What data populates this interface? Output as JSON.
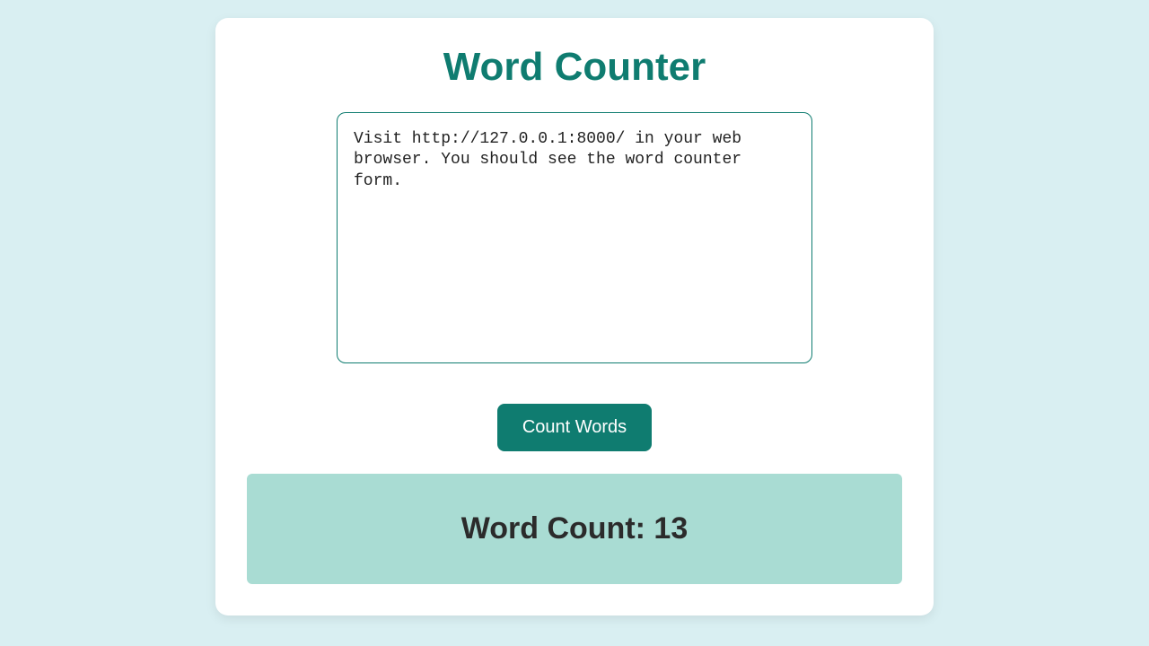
{
  "header": {
    "title": "Word Counter"
  },
  "form": {
    "textarea_value": "Visit http://127.0.0.1:8000/ in your web browser. You should see the word counter form.",
    "button_label": "Count Words"
  },
  "result": {
    "label": "Word Count: 13"
  },
  "colors": {
    "background": "#d9eff2",
    "accent": "#0f7c70",
    "result_bg": "#a9dcd3",
    "card_bg": "#ffffff",
    "text_dark": "#2b2b2b"
  }
}
